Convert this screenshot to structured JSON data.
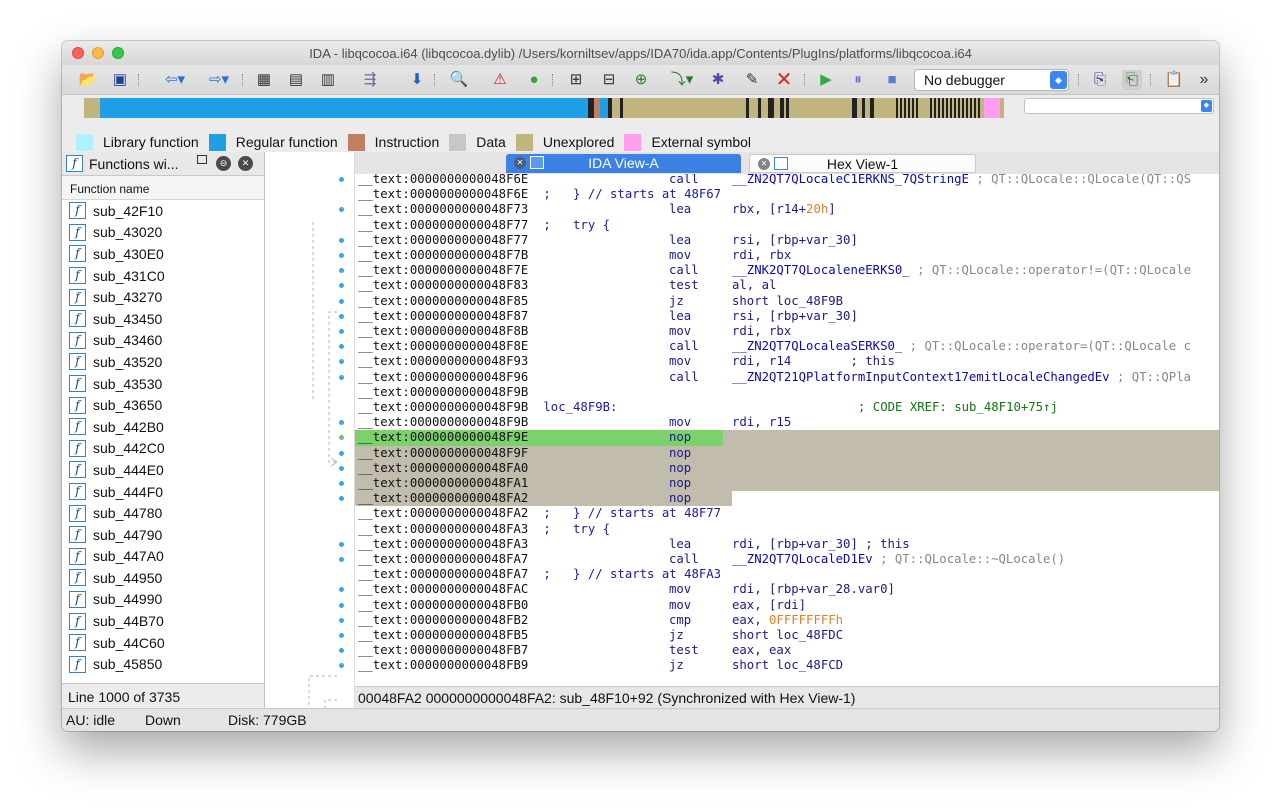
{
  "window": {
    "title": "IDA - libqcocoa.i64 (libqcocoa.dylib) /Users/korniltsev/apps/IDA70/ida.app/Contents/PlugIns/platforms/libqcocoa.i64"
  },
  "toolbar": {
    "icons": [
      "open-icon",
      "save-icon",
      "back-icon",
      "forward-icon",
      "code-icon",
      "data-icon",
      "text-icon",
      "jump-icon",
      "down-arrow-icon",
      "search-icon",
      "stop-icon",
      "run-green-icon",
      "mark-code-icon",
      "mark-data-icon",
      "struct-icon",
      "ref-icon",
      "star-icon",
      "edit-icon",
      "delete-icon",
      "play-icon",
      "pause-icon",
      "stop-debug-icon",
      "dbg-a-icon",
      "dbg-b-icon",
      "note-icon",
      "more-icon"
    ],
    "debugger": "No debugger"
  },
  "legend": [
    {
      "label": "Library function",
      "color": "#aef1ff"
    },
    {
      "label": "Regular function",
      "color": "#1f9fe6"
    },
    {
      "label": "Instruction",
      "color": "#c08060"
    },
    {
      "label": "Data",
      "color": "#c7c7c7"
    },
    {
      "label": "Unexplored",
      "color": "#c0b57f"
    },
    {
      "label": "External symbol",
      "color": "#ff9dee"
    }
  ],
  "functions_panel": {
    "title": "Functions wi...",
    "column": "Function name",
    "items": [
      "sub_42F10",
      "sub_43020",
      "sub_430E0",
      "sub_431C0",
      "sub_43270",
      "sub_43450",
      "sub_43460",
      "sub_43520",
      "sub_43530",
      "sub_43650",
      "sub_442B0",
      "sub_442C0",
      "sub_444E0",
      "sub_444F0",
      "sub_44780",
      "sub_44790",
      "sub_447A0",
      "sub_44950",
      "sub_44990",
      "sub_44B70",
      "sub_44C60",
      "sub_45850"
    ],
    "status": "Line 1000 of 3735"
  },
  "tabs": {
    "ida": "IDA View-A",
    "hex": "Hex View-1"
  },
  "disasm": {
    "l0": {
      "addr": "__text:0000000000048F6E",
      "mn": "call",
      "op": "__ZN2QT7QLocaleC1ERKNS_7QStringE",
      "cmt": " ; QT::QLocale::QLocale(QT::QS"
    },
    "l1": {
      "addr": "__text:0000000000048F6E",
      "blk": " ;   } // starts at 48F67"
    },
    "l2": {
      "addr": "__text:0000000000048F73",
      "mn": "lea",
      "op": "rbx, [r14+",
      "num": "20h",
      "op2": "]"
    },
    "l3": {
      "addr": "__text:0000000000048F77",
      "blk": " ;   try {"
    },
    "l4": {
      "addr": "__text:0000000000048F77",
      "mn": "lea",
      "op": "rsi, [rbp+var_30]"
    },
    "l5": {
      "addr": "__text:0000000000048F7B",
      "mn": "mov",
      "op": "rdi, rbx"
    },
    "l6": {
      "addr": "__text:0000000000048F7E",
      "mn": "call",
      "op": "__ZNK2QT7QLocaleneERKS0_",
      "cmt": " ; QT::QLocale::operator!=(QT::QLocale"
    },
    "l7": {
      "addr": "__text:0000000000048F83",
      "mn": "test",
      "op": "al, al"
    },
    "l8": {
      "addr": "__text:0000000000048F85",
      "mn": "jz",
      "op": "short loc_48F9B"
    },
    "l9": {
      "addr": "__text:0000000000048F87",
      "mn": "lea",
      "op": "rsi, [rbp+var_30]"
    },
    "l10": {
      "addr": "__text:0000000000048F8B",
      "mn": "mov",
      "op": "rdi, rbx"
    },
    "l11": {
      "addr": "__text:0000000000048F8E",
      "mn": "call",
      "op": "__ZN2QT7QLocaleaSERKS0_",
      "cmt": " ; QT::QLocale::operator=(QT::QLocale c"
    },
    "l12": {
      "addr": "__text:0000000000048F93",
      "mn": "mov",
      "op": "rdi, r14",
      "cmt2": "        ; this"
    },
    "l13": {
      "addr": "__text:0000000000048F96",
      "mn": "call",
      "op": "__ZN2QT21QPlatformInputContext17emitLocaleChangedEv",
      "cmt": " ; QT::QPla"
    },
    "l14": {
      "addr": "__text:0000000000048F9B"
    },
    "l15": {
      "addr": "__text:0000000000048F9B",
      "label": " loc_48F9B:",
      "xref": "; CODE XREF: sub_48F10+75↑j"
    },
    "l16": {
      "addr": "__text:0000000000048F9B",
      "mn": "mov",
      "op": "rdi, r15"
    },
    "l17": {
      "addr": "__text:0000000000048F9E",
      "mn": "nop"
    },
    "l18": {
      "addr": "__text:0000000000048F9F",
      "mn": "nop"
    },
    "l19": {
      "addr": "__text:0000000000048FA0",
      "mn": "nop"
    },
    "l20": {
      "addr": "__text:0000000000048FA1",
      "mn": "nop"
    },
    "l21": {
      "addr": "__text:0000000000048FA2",
      "mn": "nop"
    },
    "l22": {
      "addr": "__text:0000000000048FA2",
      "blk": " ;   } // starts at 48F77"
    },
    "l23": {
      "addr": "__text:0000000000048FA3",
      "blk": " ;   try {"
    },
    "l24": {
      "addr": "__text:0000000000048FA3",
      "mn": "lea",
      "op": "rdi, [rbp+var_30]",
      "cmt3": " ; this"
    },
    "l25": {
      "addr": "__text:0000000000048FA7",
      "mn": "call",
      "op": "__ZN2QT7QLocaleD1Ev",
      "cmt": " ; QT::QLocale::~QLocale()"
    },
    "l26": {
      "addr": "__text:0000000000048FA7",
      "blk": " ;   } // starts at 48FA3"
    },
    "l27": {
      "addr": "__text:0000000000048FAC",
      "mn": "mov",
      "op": "rdi, [rbp+var_28.var0]"
    },
    "l28": {
      "addr": "__text:0000000000048FB0",
      "mn": "mov",
      "op": "eax, [rdi]"
    },
    "l29": {
      "addr": "__text:0000000000048FB2",
      "mn": "cmp",
      "op": "eax, ",
      "num": "0FFFFFFFFh"
    },
    "l30": {
      "addr": "__text:0000000000048FB5",
      "mn": "jz",
      "op": "short loc_48FDC"
    },
    "l31": {
      "addr": "__text:0000000000048FB7",
      "mn": "test",
      "op": "eax, eax"
    },
    "l32": {
      "addr": "__text:0000000000048FB9",
      "mn": "jz",
      "op": "short loc_48FCD"
    }
  },
  "disasm_status": "00048FA2 0000000000048FA2: sub_48F10+92  (Synchronized with Hex View-1)",
  "statusbar": {
    "au": "AU:  idle",
    "dir": "Down",
    "disk": "Disk: 779GB"
  }
}
